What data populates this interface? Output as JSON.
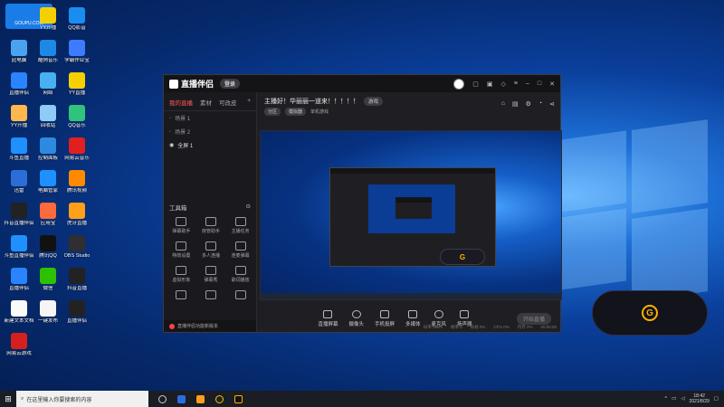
{
  "watermark": {
    "text": "GOUPU.COM"
  },
  "desktop_icons": [
    {
      "label": "",
      "color": "#f0c419"
    },
    {
      "label": "YY开播",
      "color": "#f5d000"
    },
    {
      "label": "QQ影音",
      "color": "#1a8ef0"
    },
    {
      "label": "此电脑",
      "color": "#4aa3f0"
    },
    {
      "label": "酷狗音乐",
      "color": "#1e88e5"
    },
    {
      "label": "学霸作业宝",
      "color": "#3d7bff"
    },
    {
      "label": "直播伴侣",
      "color": "#2a84ff"
    },
    {
      "label": "网络",
      "color": "#48b0f0"
    },
    {
      "label": "YY直播",
      "color": "#f5d000"
    },
    {
      "label": "YY开播",
      "color": "#ffb84d"
    },
    {
      "label": "回收站",
      "color": "#8ecbf5"
    },
    {
      "label": "QQ音乐",
      "color": "#31c27c"
    },
    {
      "label": "斗鱼直播",
      "color": "#1e90ff"
    },
    {
      "label": "控制面板",
      "color": "#2d8ae0"
    },
    {
      "label": "网易云音乐",
      "color": "#e02020"
    },
    {
      "label": "迅雷",
      "color": "#2b6fd6"
    },
    {
      "label": "电脑管家",
      "color": "#1e90ff"
    },
    {
      "label": "腾讯视频",
      "color": "#ff8a00"
    },
    {
      "label": "抖音直播伴侣",
      "color": "#222"
    },
    {
      "label": "应用宝",
      "color": "#ff6a3d"
    },
    {
      "label": "虎牙直播",
      "color": "#ff9f1a"
    },
    {
      "label": "斗鱼直播伴侣",
      "color": "#1e90ff"
    },
    {
      "label": "腾讯QQ",
      "color": "#111"
    },
    {
      "label": "OBS Studio",
      "color": "#302e31"
    },
    {
      "label": "直播伴侣",
      "color": "#2a84ff"
    },
    {
      "label": "微信",
      "color": "#2dc100"
    },
    {
      "label": "抖音直播",
      "color": "#222"
    },
    {
      "label": "新建文本文档",
      "color": "#fafafa"
    },
    {
      "label": "一键发布",
      "color": "#f5f5f5"
    },
    {
      "label": "直播伴侣",
      "color": "#222"
    },
    {
      "label": "网易云游戏",
      "color": "#d62020"
    }
  ],
  "app": {
    "brand": "直播伴侣",
    "brand_badge": "登录",
    "left_tabs": [
      "我的直播",
      "素材",
      "可改皮"
    ],
    "scenes": [
      "场景 1",
      "场景 2",
      "全屏 1"
    ],
    "tools_title": "工具箱",
    "tools": [
      "弹幕助手",
      "房管助手",
      "主播任务",
      "特效设置",
      "多人连播",
      "连麦弹幕",
      "虚拟形象",
      "弹幕秀",
      "歌词播放",
      "",
      "",
      ""
    ],
    "notice": "直播伴侣功能新版本",
    "room_title": "主播好！华丽丽一道来！！！！！",
    "room_title_tag": "游戏",
    "room_sub": [
      "分区",
      "模拟器",
      "单机游戏"
    ],
    "controls": [
      "直播屏幕",
      "摄像头",
      "手机投屏",
      "多媒体",
      "麦克风",
      "扬声器"
    ],
    "golive": "开始直播",
    "stats": [
      "码率 0kb/s",
      "帧率 0",
      "丢帧 0%",
      "CPU 0%",
      "内存 0%",
      "00:00:00"
    ]
  },
  "badge_glyph": "G",
  "taskbar": {
    "search_placeholder": "在这里输入你要搜索的内容",
    "time": "18:42",
    "date": "2021/8/29"
  }
}
